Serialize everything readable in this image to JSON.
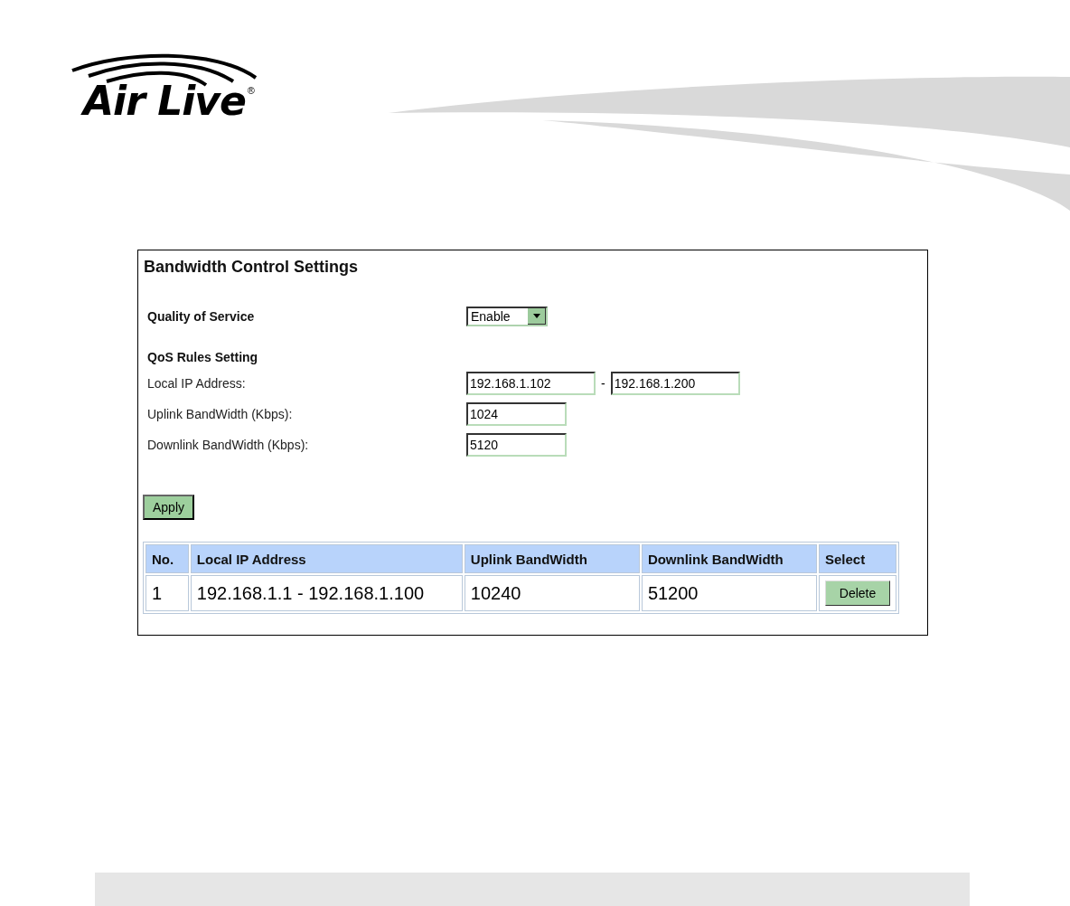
{
  "logo": {
    "text": "Air Live",
    "mark": "®"
  },
  "panel": {
    "title": "Bandwidth Control Settings",
    "qos": {
      "label": "Quality of Service",
      "value": "Enable"
    },
    "rules_heading": "QoS Rules Setting",
    "fields": [
      {
        "label": "Local IP Address:",
        "values": [
          "192.168.1.102",
          "192.168.1.200"
        ],
        "separator": "-"
      },
      {
        "label": "Uplink BandWidth (Kbps):",
        "values": [
          "1024"
        ]
      },
      {
        "label": "Downlink BandWidth (Kbps):",
        "values": [
          "5120"
        ]
      }
    ],
    "apply_button": "Apply",
    "table": {
      "columns": [
        "No.",
        "Local IP Address",
        "Uplink BandWidth",
        "Downlink BandWidth",
        "Select"
      ],
      "rows": [
        {
          "cells": [
            "1",
            "192.168.1.1 - 192.168.1.100",
            "10240",
            "51200"
          ],
          "action": "Delete"
        }
      ]
    }
  }
}
